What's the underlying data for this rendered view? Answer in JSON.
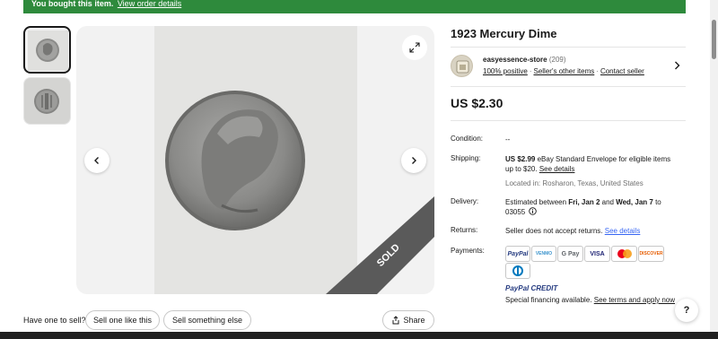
{
  "banner": {
    "text": "You bought this item.",
    "link": "View order details"
  },
  "item": {
    "title": "1923 Mercury Dime",
    "price": "US $2.30",
    "sold_ribbon": "SOLD"
  },
  "seller": {
    "name": "easyessence-store",
    "feedback_count": "(209)",
    "positive": "100% positive",
    "other_items": "Seller's other items",
    "contact": "Contact seller"
  },
  "details": {
    "condition_label": "Condition:",
    "condition_value": "--",
    "shipping_label": "Shipping:",
    "shipping_price": "US $2.99",
    "shipping_text": " eBay Standard Envelope for eligible items up to $20. ",
    "shipping_link": "See details",
    "located": "Located in: Rosharon, Texas, United States",
    "delivery_label": "Delivery:",
    "delivery_prefix": "Estimated between ",
    "delivery_start": "Fri, Jan 2",
    "delivery_and": " and ",
    "delivery_end": "Wed, Jan 7",
    "delivery_suffix": " to 03055",
    "returns_label": "Returns:",
    "returns_text": "Seller does not accept returns. ",
    "returns_link": "See details",
    "payments_label": "Payments:",
    "payment_methods": [
      "PayPal",
      "VENMO",
      "G Pay",
      "VISA",
      "DISCOVER"
    ],
    "paypal_credit": "PayPal CREDIT",
    "financing_text": "Special financing available. ",
    "financing_link": "See terms and apply now"
  },
  "actions": {
    "have_one": "Have one to sell?",
    "sell_like": "Sell one like this",
    "sell_else": "Sell something else",
    "share": "Share",
    "help": "?"
  },
  "colors": {
    "banner_green": "#2e8a3c",
    "link_blue": "#3665f3",
    "sold_ribbon": "#5a5a5a"
  }
}
